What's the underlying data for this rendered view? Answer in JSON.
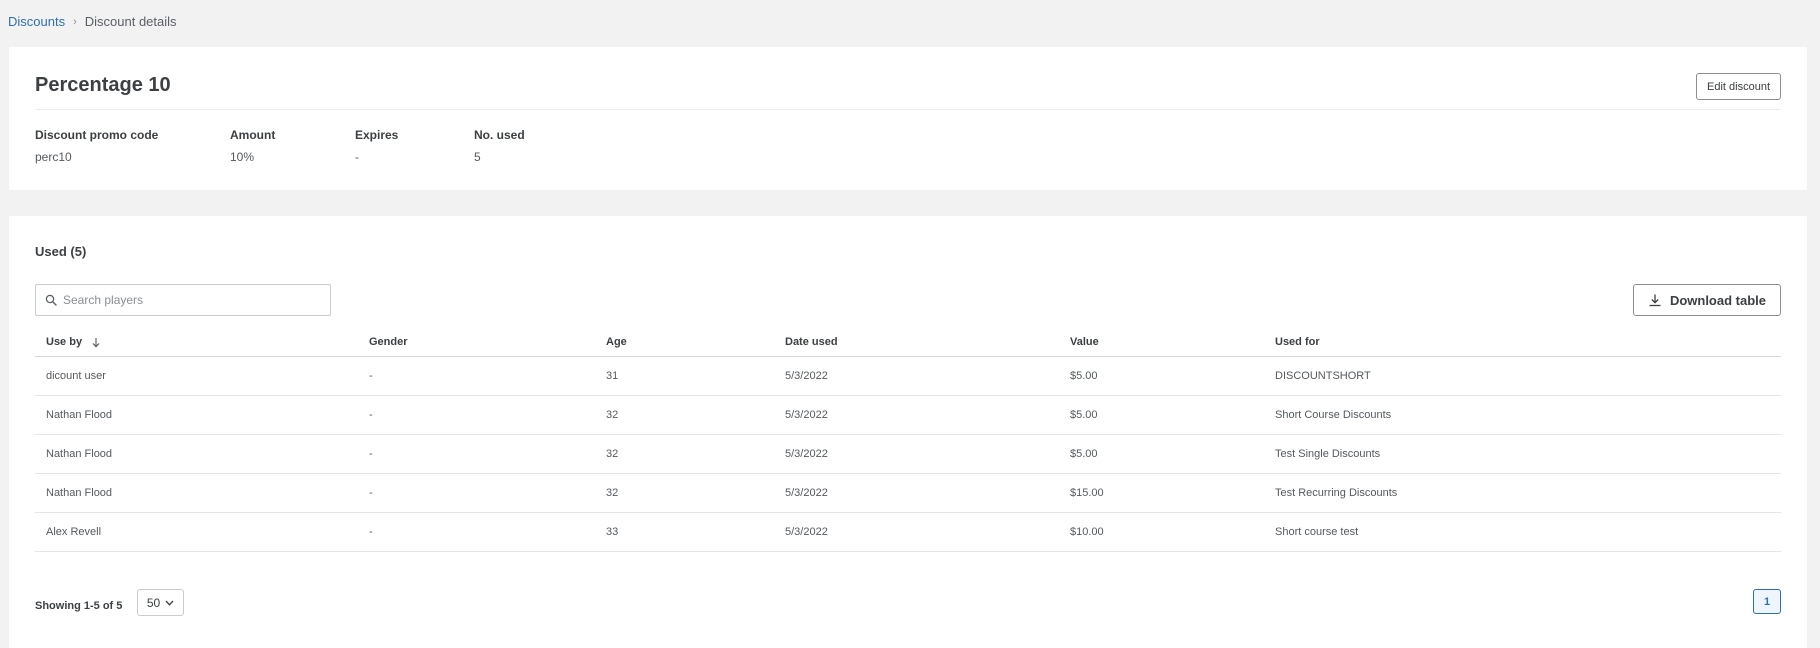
{
  "breadcrumb": {
    "parent": "Discounts",
    "separator": "›",
    "current": "Discount details"
  },
  "discount": {
    "title": "Percentage 10",
    "edit_label": "Edit discount",
    "fields": [
      {
        "label": "Discount promo code",
        "value": "perc10"
      },
      {
        "label": "Amount",
        "value": "10%"
      },
      {
        "label": "Expires",
        "value": "-"
      },
      {
        "label": "No. used",
        "value": "5"
      }
    ]
  },
  "used": {
    "title": "Used (5)",
    "search_placeholder": "Search players",
    "search_value": "",
    "download_label": "Download table",
    "columns": [
      "Use by",
      "Gender",
      "Age",
      "Date used",
      "Value",
      "Used for"
    ],
    "sort_column": "Use by",
    "rows": [
      [
        "dicount user",
        "-",
        "31",
        "5/3/2022",
        "$5.00",
        "DISCOUNTSHORT"
      ],
      [
        "Nathan Flood",
        "-",
        "32",
        "5/3/2022",
        "$5.00",
        "Short Course Discounts"
      ],
      [
        "Nathan Flood",
        "-",
        "32",
        "5/3/2022",
        "$5.00",
        "Test Single Discounts"
      ],
      [
        "Nathan Flood",
        "-",
        "32",
        "5/3/2022",
        "$15.00",
        "Test Recurring Discounts"
      ],
      [
        "Alex Revell",
        "-",
        "33",
        "5/3/2022",
        "$10.00",
        "Short course test"
      ]
    ],
    "showing": "Showing 1-5 of 5",
    "per_page": "50",
    "current_page": "1"
  },
  "icons": {
    "search": "search-icon",
    "download": "download-icon",
    "sort": "arrow-down-icon",
    "dropdown": "chevron-down-icon"
  },
  "colors": {
    "link": "#2f6fb0",
    "background": "#f2f2f2",
    "card": "#ffffff"
  }
}
